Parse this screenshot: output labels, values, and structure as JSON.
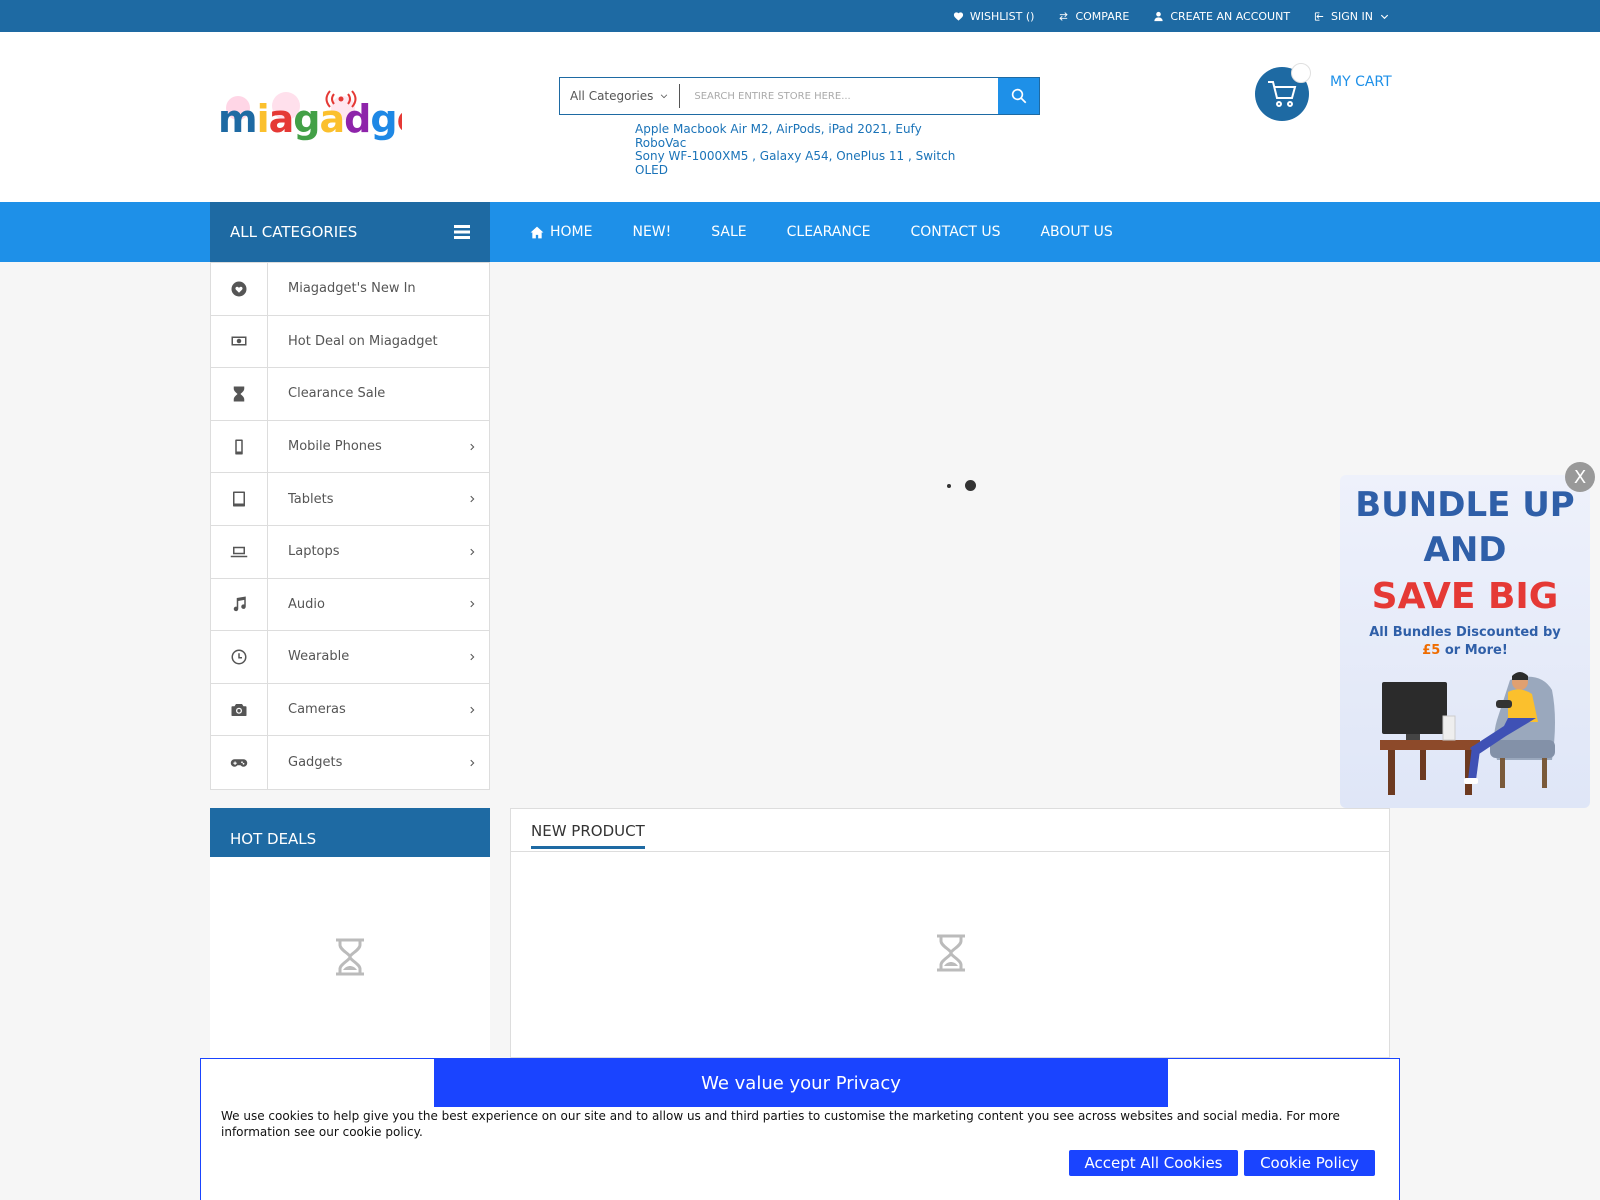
{
  "topbar": {
    "links": [
      {
        "label": "WISHLIST ()",
        "icon": "heart-icon"
      },
      {
        "label": "COMPARE",
        "icon": "compare-icon"
      },
      {
        "label": "CREATE AN ACCOUNT",
        "icon": "user-icon"
      },
      {
        "label": "SIGN IN",
        "icon": "sign-in-icon"
      }
    ]
  },
  "header": {
    "logo_text": "miagadget",
    "search": {
      "category_label": "All Categories",
      "placeholder": "SEARCH ENTIRE STORE HERE..."
    },
    "hot_links": {
      "line1": "Apple Macbook Air M2, AirPods, iPad 2021, Eufy RoboVac",
      "line2": "Sony WF-1000XM5 , Galaxy A54, OnePlus 11 , Switch OLED"
    },
    "cart_label": "MY CART"
  },
  "nav": {
    "all_categories": "ALL CATEGORIES",
    "links": [
      "HOME",
      "NEW!",
      "SALE",
      "CLEARANCE",
      "CONTACT US",
      "ABOUT US"
    ]
  },
  "categories": [
    {
      "label": "Miagadget's New In",
      "icon": "heart-icon",
      "has_submenu": false
    },
    {
      "label": "Hot Deal on Miagadget",
      "icon": "money-icon",
      "has_submenu": false
    },
    {
      "label": "Clearance Sale",
      "icon": "hourglass-icon",
      "has_submenu": false
    },
    {
      "label": "Mobile Phones",
      "icon": "mobile-icon",
      "has_submenu": true
    },
    {
      "label": "Tablets",
      "icon": "tablet-icon",
      "has_submenu": true
    },
    {
      "label": "Laptops",
      "icon": "laptop-icon",
      "has_submenu": true
    },
    {
      "label": "Audio",
      "icon": "music-icon",
      "has_submenu": true
    },
    {
      "label": "Wearable",
      "icon": "clock-icon",
      "has_submenu": true
    },
    {
      "label": "Cameras",
      "icon": "camera-icon",
      "has_submenu": true
    },
    {
      "label": "Gadgets",
      "icon": "gamepad-icon",
      "has_submenu": true
    }
  ],
  "hot_deals": {
    "title": "HOT DEALS"
  },
  "new_product": {
    "tab": "NEW PRODUCT"
  },
  "promo": {
    "line1": "BUNDLE UP",
    "line2": "AND",
    "line3": "SAVE BIG",
    "sub1": "All Bundles Discounted by",
    "sub2_amount": "£5",
    "sub2_rest": "or More!",
    "close": "X"
  },
  "cookie": {
    "title": "We value your Privacy",
    "text": "We use cookies to help give you the best experience on our site and to allow us and third parties to customise the marketing content you see across websites and social media. For more information see our cookie policy.",
    "accept": "Accept All Cookies",
    "policy": "Cookie Policy"
  },
  "colors": {
    "dark_blue": "#1e6aa3",
    "bright_blue": "#1e90e8",
    "cookie_blue": "#1a44ff",
    "promo_red": "#e53935"
  }
}
